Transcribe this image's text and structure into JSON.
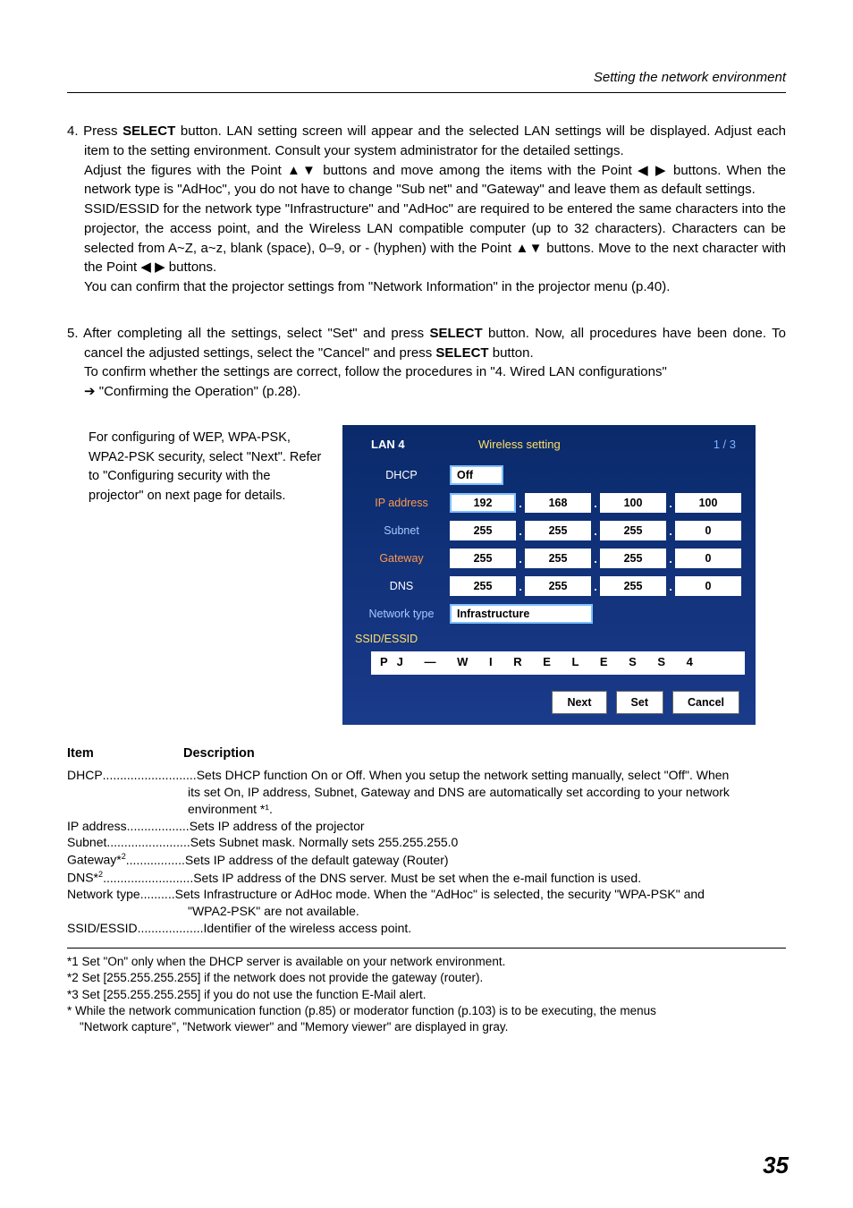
{
  "header": {
    "section_title": "Setting  the network environment"
  },
  "step4": {
    "line1_prefix": "4. Press ",
    "bold_select_1": "SELECT",
    "line1_rest": " button. LAN setting screen will appear and the selected LAN settings will be displayed. Adjust each item to the setting environment. Consult your system administrator for the detailed settings.",
    "para2_a": "Adjust the figures with the Point ",
    "tri_ud_1": "▲▼",
    "para2_b": " buttons and move among the items with the Point ",
    "tri_lr_1": "◀ ▶",
    "para2_c": " buttons. When the network type is \"AdHoc\", you do not have to change \"Sub net\" and \"Gateway\" and leave them as default settings.",
    "para3_a": "SSID/ESSID for the network type \"Infrastructure\" and \"AdHoc\" are required to be entered the same characters into the projector, the access point, and the Wireless LAN compatible computer (up to 32 characters). Characters can be selected from A~Z, a~z, blank (space), 0–9, or - (hyphen) with the Point ",
    "tri_ud_2": "▲▼",
    "para3_b": " buttons. Move to the next character with the Point ",
    "tri_lr_2": "◀ ▶",
    "para3_c": " buttons.",
    "para4": "You can confirm that the projector settings from \"Network Information\" in the projector menu (p.40)."
  },
  "step5": {
    "line1_a": "5. After completing all the settings, select \"Set\" and press ",
    "bold_select_1": "SELECT",
    "line1_b": " button. Now, all procedures have been done. To cancel the adjusted settings, select the \"Cancel\" and press ",
    "bold_select_2": "SELECT",
    "line1_c": " button.",
    "line2": "To confirm whether the settings are correct, follow the procedures in \"4. Wired LAN configurations\"",
    "line3_arrow": "➔",
    "line3_rest": " \"Confirming the Operation\" (p.28)."
  },
  "side_text": "For configuring of WEP, WPA-PSK, WPA2-PSK security, select \"Next\". Refer to  \"Configuring security with the projector\" on next page for details.",
  "screen": {
    "lan_title": "LAN 4",
    "wireless_title": "Wireless setting",
    "page_indicator": "1 / 3",
    "labels": {
      "dhcp": "DHCP",
      "ip": "IP address",
      "subnet": "Subnet",
      "gateway": "Gateway",
      "dns": "DNS",
      "nettype": "Network type",
      "ssid": "SSID/ESSID"
    },
    "dhcp_value": "Off",
    "ip": [
      "192",
      "168",
      "100",
      "100"
    ],
    "subnet": [
      "255",
      "255",
      "255",
      "0"
    ],
    "gateway": [
      "255",
      "255",
      "255",
      "0"
    ],
    "dns": [
      "255",
      "255",
      "255",
      "0"
    ],
    "nettype_value": "Infrastructure",
    "essid_value": "PJ — W I R E L E S S 4",
    "buttons": {
      "next": "Next",
      "set": "Set",
      "cancel": "Cancel"
    }
  },
  "table": {
    "header_item": "Item",
    "header_desc": "Description",
    "rows": [
      {
        "name": "DHCP",
        "dots": "...........................",
        "desc_lines": [
          "Sets DHCP function On or Off. When you setup the network setting manually, select \"Off\". When",
          "its set On, IP address, Subnet, Gateway and DNS are automatically set according to your network",
          "environment *¹."
        ]
      },
      {
        "name": "IP address",
        "dots": " ..................",
        "desc_lines": [
          "Sets IP address of the projector"
        ]
      },
      {
        "name": "Subnet",
        "dots": "........................",
        "desc_lines": [
          "Sets Subnet mask. Normally sets 255.255.255.0"
        ]
      },
      {
        "name": "Gateway*",
        "sup": "2",
        "dots": ".................",
        "desc_lines": [
          "Sets IP address of the default gateway (Router)"
        ]
      },
      {
        "name": "DNS*",
        "sup": "2",
        "dots": "..........................",
        "desc_lines": [
          "Sets IP address of the DNS server. Must be set when the e-mail function is used."
        ]
      },
      {
        "name": "Network type",
        "dots": " ..........",
        "desc_lines": [
          "Sets Infrastructure or AdHoc mode. When the \"AdHoc\" is selected, the security \"WPA-PSK\" and",
          "\"WPA2-PSK\" are not available."
        ]
      },
      {
        "name": "SSID/ESSID",
        "dots": "...................",
        "desc_lines": [
          "Identifier of the wireless access point."
        ]
      }
    ]
  },
  "footnotes": {
    "f1": "*1 Set \"On\" only when the DHCP server is available on your network environment.",
    "f2": "*2 Set [255.255.255.255] if the network does not provide the gateway (router).",
    "f3": "*3 Set [255.255.255.255] if you do not use the function E-Mail alert.",
    "f4_a": "* While the network communication function (p.85) or moderator function (p.103) is to be executing, the menus",
    "f4_b": "\"Network capture\", \"Network viewer\" and \"Memory viewer\" are displayed in gray."
  },
  "page_number": "35"
}
